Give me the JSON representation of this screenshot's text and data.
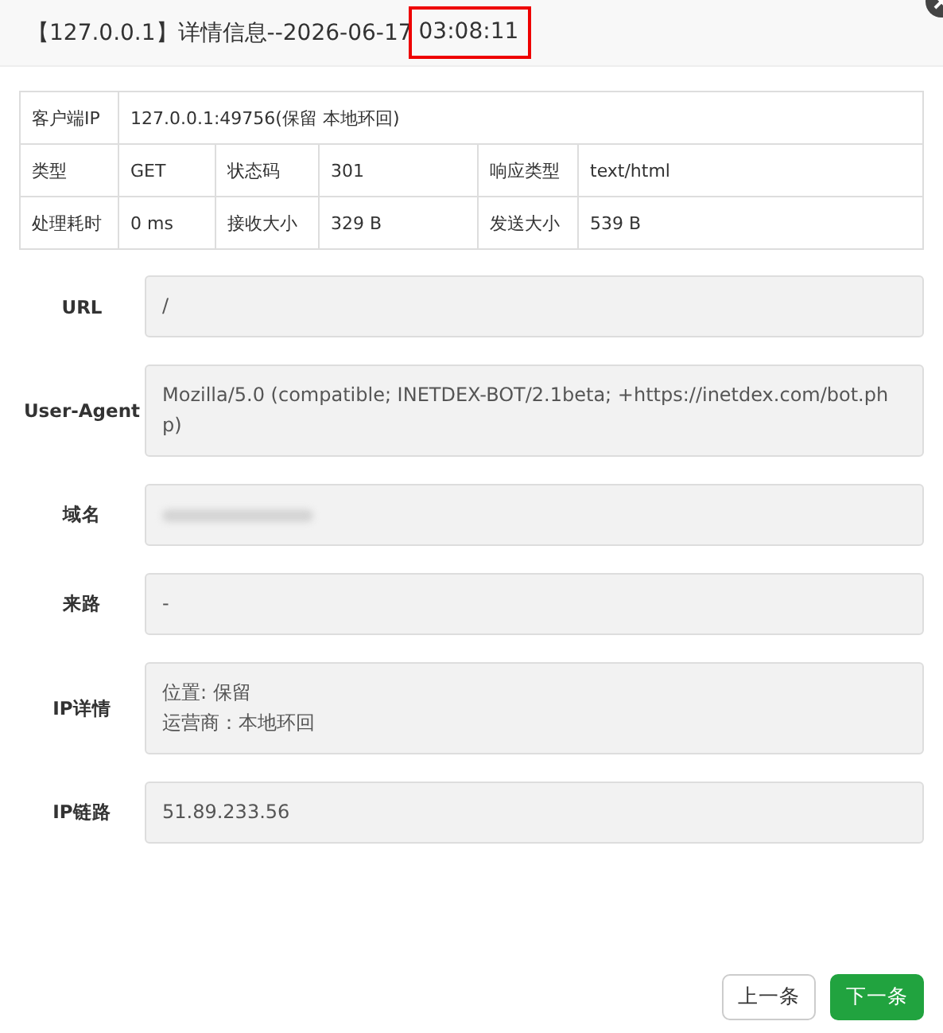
{
  "window": {
    "title": "【127.0.0.1】详情信息--2026-06-17",
    "title_highlight": "03:08:11"
  },
  "summary": {
    "rows": [
      [
        {
          "label": "客户端IP",
          "value": "127.0.0.1:49756(保留 本地环回)"
        }
      ],
      [
        {
          "label": "类型",
          "value": "GET"
        },
        {
          "label": "状态码",
          "value": "301"
        },
        {
          "label": "响应类型",
          "value": "text/html"
        }
      ],
      [
        {
          "label": "处理耗时",
          "value": "0 ms"
        },
        {
          "label": "接收大小",
          "value": "329 B"
        },
        {
          "label": "发送大小",
          "value": "539 B"
        }
      ]
    ]
  },
  "fields": [
    {
      "label": "URL",
      "kind": "text",
      "lines": [
        "/"
      ]
    },
    {
      "label": "User-Agent",
      "kind": "text",
      "lines": [
        "Mozilla/5.0 (compatible; INETDEX-BOT/2.1beta; +https://inetdex.com/bot.php)"
      ]
    },
    {
      "label": "域名",
      "kind": "blurred"
    },
    {
      "label": "来路",
      "kind": "text",
      "lines": [
        "-"
      ]
    },
    {
      "label": "IP详情",
      "kind": "text",
      "lines": [
        "位置: 保留",
        "运营商：本地环回"
      ]
    },
    {
      "label": "IP链路",
      "kind": "text",
      "lines": [
        "51.89.233.56"
      ]
    }
  ],
  "buttons": [
    {
      "label": "上一条",
      "primary": false
    },
    {
      "label": "下一条",
      "primary": true
    }
  ]
}
